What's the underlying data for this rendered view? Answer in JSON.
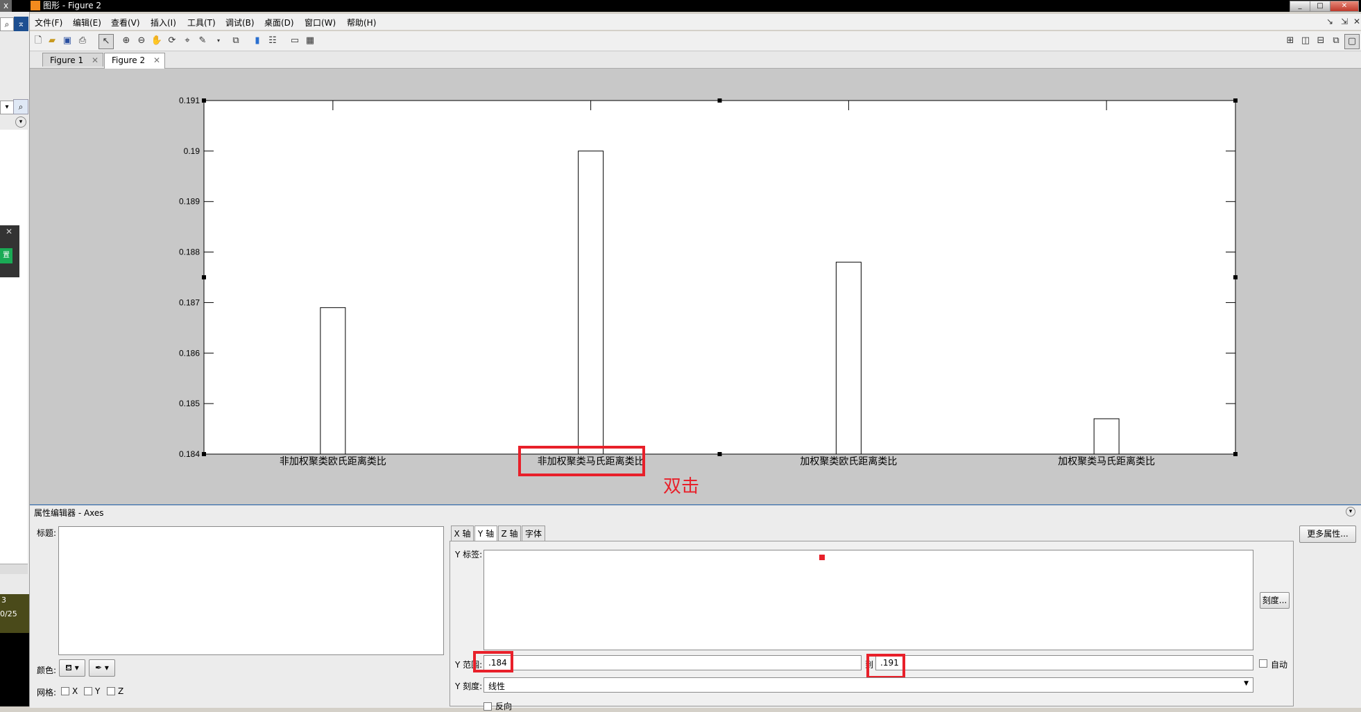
{
  "window": {
    "title": "图形 - Figure 2",
    "left_edge_glyph": "x"
  },
  "menubar": [
    "文件(F)",
    "编辑(E)",
    "查看(V)",
    "插入(I)",
    "工具(T)",
    "调试(B)",
    "桌面(D)",
    "窗口(W)",
    "帮助(H)"
  ],
  "tabs": [
    {
      "label": "Figure 1",
      "active": false
    },
    {
      "label": "Figure 2",
      "active": true
    }
  ],
  "left_strip": {
    "badge": "置",
    "line1": "3",
    "line2": "0/25"
  },
  "chart_data": {
    "type": "bar",
    "categories": [
      "非加权聚类欧氏距离类比",
      "非加权聚类马氏距离类比",
      "加权聚类欧氏距离类比",
      "加权聚类马氏距离类比"
    ],
    "values": [
      0.1869,
      0.19,
      0.1878,
      0.1847
    ],
    "ylim": [
      0.184,
      0.191
    ],
    "yticks": [
      "0.184",
      "0.185",
      "0.186",
      "0.187",
      "0.188",
      "0.189",
      "0.19",
      "0.191"
    ],
    "grid": false,
    "bar_fill": "#ffffff",
    "bar_edge": "#000000"
  },
  "annotation": {
    "text": "双击",
    "color": "#e8202a"
  },
  "prop_editor": {
    "header": "属性编辑器 - Axes",
    "title_label": "标题:",
    "color_label": "颜色:",
    "grid_label": "网格:",
    "grid_x": "X",
    "grid_y": "Y",
    "grid_z": "Z",
    "axis_tabs": [
      "X 轴",
      "Y 轴",
      "Z 轴",
      "字体"
    ],
    "ylabel_label": "Y 标签:",
    "ylimits_label": "Y 范围:",
    "ylimits_min": ".184",
    "ylimits_to": "到",
    "ylimits_max": ".191",
    "auto_label": "自动",
    "yscale_label": "Y 刻度:",
    "yscale_value": "线性",
    "reverse_label": "反向",
    "ticks_button": "刻度...",
    "more_props_button": "更多属性..."
  },
  "colors": {
    "highlight_red": "#e8202a",
    "figure_bg": "#c8c8c8",
    "editor_border": "#6b8fb8"
  }
}
